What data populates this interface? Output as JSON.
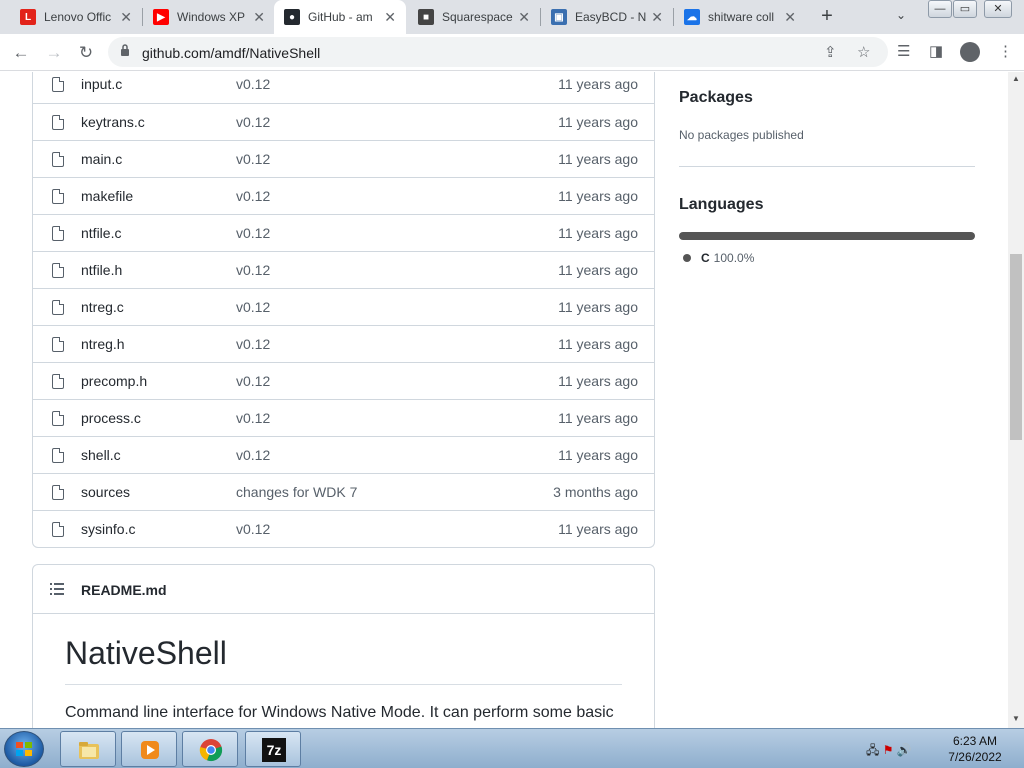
{
  "browser": {
    "tabs": [
      {
        "title": "Lenovo Offic",
        "favicon": "lenovo-icon",
        "color": "#e2231a",
        "glyph": "L"
      },
      {
        "title": "Windows XP",
        "favicon": "youtube-icon",
        "color": "#ff0000",
        "glyph": "▶"
      },
      {
        "title": "GitHub - am",
        "favicon": "github-icon",
        "color": "#24292f",
        "glyph": "●",
        "active": true
      },
      {
        "title": "Squarespace",
        "favicon": "squarespace-icon",
        "color": "#444444",
        "glyph": "■"
      },
      {
        "title": "EasyBCD - N",
        "favicon": "easybcd-icon",
        "color": "#3a6fb0",
        "glyph": "▣"
      },
      {
        "title": "shitware coll",
        "favicon": "cloud-icon",
        "color": "#1a73e8",
        "glyph": "☁"
      }
    ],
    "url": "github.com/amdf/NativeShell"
  },
  "files": [
    {
      "name": "input.c",
      "message": "v0.12",
      "age": "11 years ago"
    },
    {
      "name": "keytrans.c",
      "message": "v0.12",
      "age": "11 years ago"
    },
    {
      "name": "main.c",
      "message": "v0.12",
      "age": "11 years ago"
    },
    {
      "name": "makefile",
      "message": "v0.12",
      "age": "11 years ago"
    },
    {
      "name": "ntfile.c",
      "message": "v0.12",
      "age": "11 years ago"
    },
    {
      "name": "ntfile.h",
      "message": "v0.12",
      "age": "11 years ago"
    },
    {
      "name": "ntreg.c",
      "message": "v0.12",
      "age": "11 years ago"
    },
    {
      "name": "ntreg.h",
      "message": "v0.12",
      "age": "11 years ago"
    },
    {
      "name": "precomp.h",
      "message": "v0.12",
      "age": "11 years ago"
    },
    {
      "name": "process.c",
      "message": "v0.12",
      "age": "11 years ago"
    },
    {
      "name": "shell.c",
      "message": "v0.12",
      "age": "11 years ago"
    },
    {
      "name": "sources",
      "message": "changes for WDK 7",
      "age": "3 months ago"
    },
    {
      "name": "sysinfo.c",
      "message": "v0.12",
      "age": "11 years ago"
    }
  ],
  "readme": {
    "filename": "README.md",
    "heading": "NativeShell",
    "text": "Command line interface for Windows Native Mode. It can perform some basic"
  },
  "sidebar": {
    "packages_title": "Packages",
    "packages_text": "No packages published",
    "languages_title": "Languages",
    "languages": [
      {
        "name": "C",
        "percent": "100.0%",
        "color": "#555555"
      }
    ]
  },
  "taskbar": {
    "time": "6:23 AM",
    "date": "7/26/2022",
    "apps": [
      "explorer-icon",
      "media-player-icon",
      "chrome-icon",
      "7zip-icon"
    ],
    "sevenzip_label": "7z"
  }
}
